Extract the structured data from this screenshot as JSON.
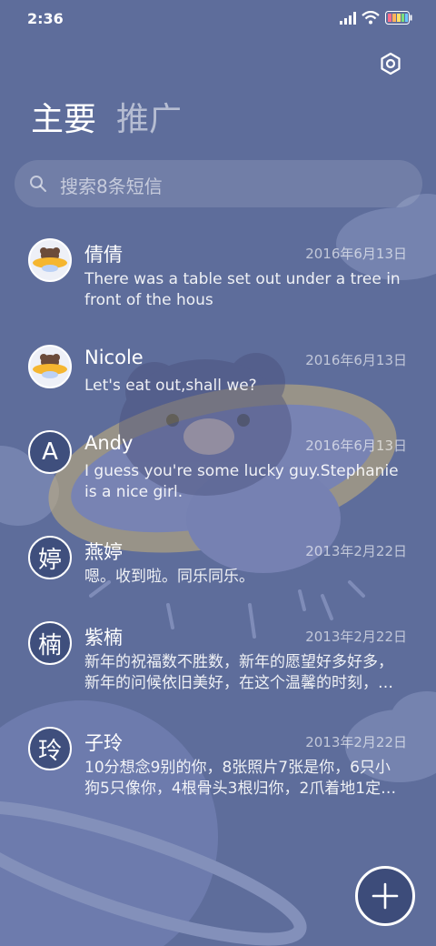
{
  "status_bar": {
    "time": "2:36",
    "battery_colors": [
      "#ff6b8a",
      "#ffb35c",
      "#ffe066",
      "#7be07b",
      "#6bc8ff"
    ]
  },
  "header": {
    "settings_icon": "gear-icon",
    "tabs": [
      {
        "label": "主要",
        "active": true
      },
      {
        "label": "推广",
        "active": false
      }
    ]
  },
  "search": {
    "placeholder": "搜索8条短信",
    "icon": "search-icon"
  },
  "messages": [
    {
      "name": "倩倩",
      "date": "2016年6月13日",
      "preview": "There was a table set out under a tree in front of the hous",
      "avatar_type": "image",
      "avatar_icon": "ufo-bear-icon"
    },
    {
      "name": "Nicole",
      "date": "2016年6月13日",
      "preview": "Let's eat out,shall we?",
      "avatar_type": "image",
      "avatar_icon": "ufo-bear-icon"
    },
    {
      "name": "Andy",
      "date": "2016年6月13日",
      "preview": "I guess you're some lucky guy.Stephanie is a nice girl.",
      "avatar_type": "letter",
      "avatar_letter": "A"
    },
    {
      "name": "燕婷",
      "date": "2013年2月22日",
      "preview": "嗯。收到啦。同乐同乐。",
      "avatar_type": "letter",
      "avatar_letter": "婷"
    },
    {
      "name": "紫楠",
      "date": "2013年2月22日",
      "preview": "新年的祝福数不胜数，新年的愿望好多好多，新年的问候依旧美好，在这个温馨的时刻，…",
      "avatar_type": "letter",
      "avatar_letter": "楠"
    },
    {
      "name": "子玲",
      "date": "2013年2月22日",
      "preview": "10分想念9别的你，8张照片7张是你，6只小狗5只像你，4根骨头3根归你，2爪着地1定…",
      "avatar_type": "letter",
      "avatar_letter": "玲"
    }
  ],
  "fab": {
    "icon": "plus-icon"
  },
  "colors": {
    "background": "#5e6d9b",
    "fab": "#3d4c7a"
  }
}
